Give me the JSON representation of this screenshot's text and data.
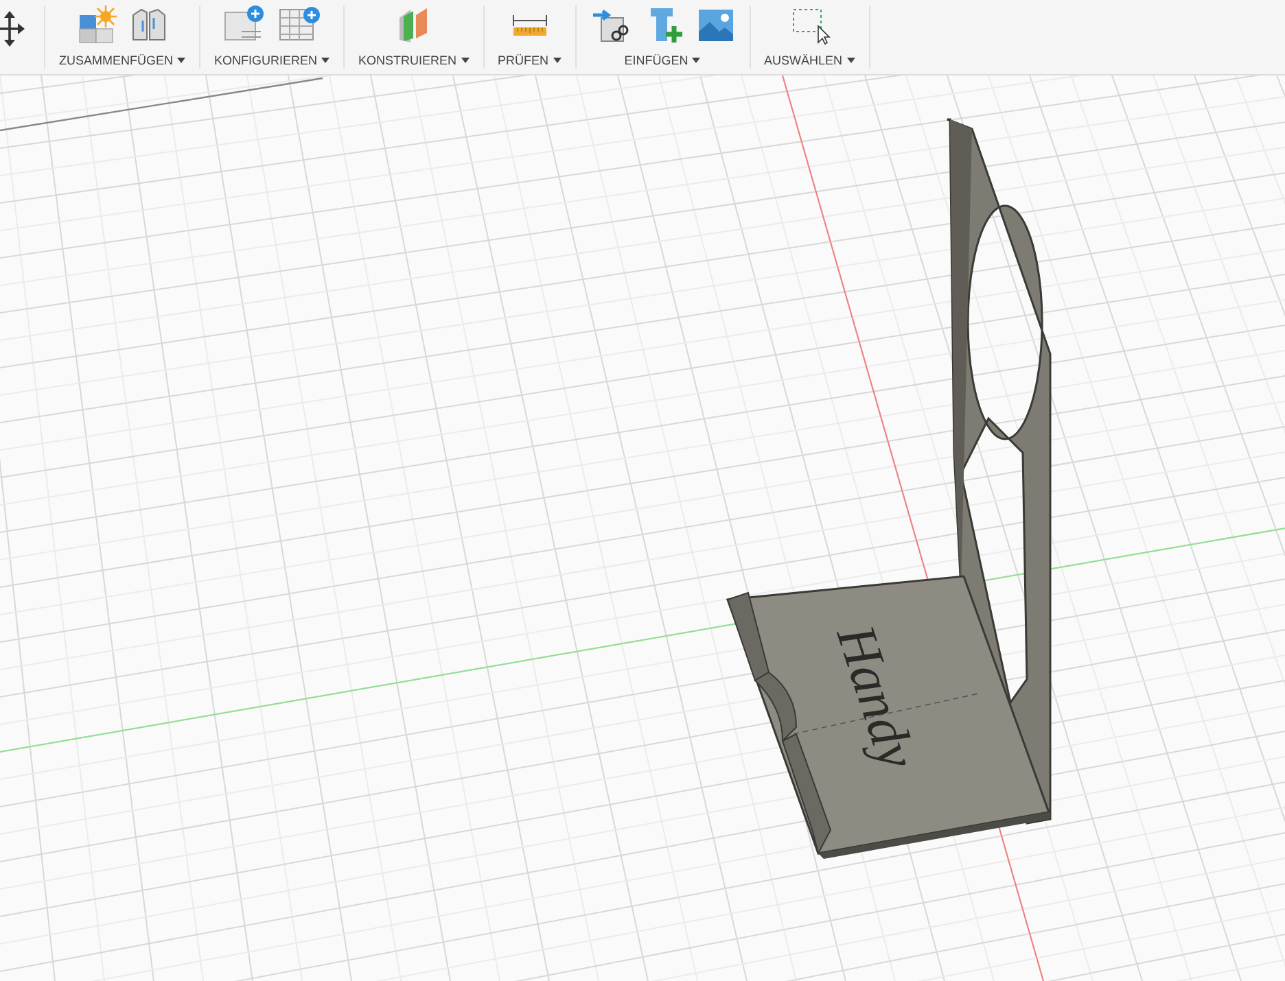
{
  "toolbar": {
    "groups": [
      {
        "label": "ZUSAMMENFÜGEN"
      },
      {
        "label": "KONFIGURIEREN"
      },
      {
        "label": "KONSTRUIEREN"
      },
      {
        "label": "PRÜFEN"
      },
      {
        "label": "EINFÜGEN"
      },
      {
        "label": "AUSWÄHLEN"
      }
    ]
  },
  "viewport": {
    "model": {
      "engraving": "Handy"
    }
  }
}
